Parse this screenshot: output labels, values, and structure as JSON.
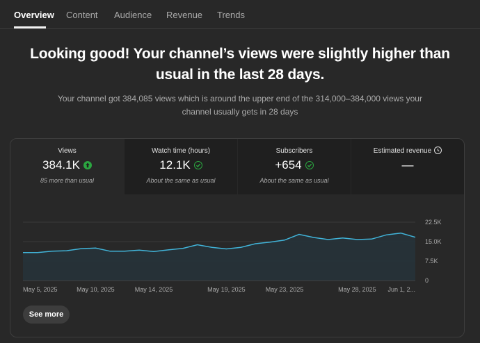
{
  "tabs": [
    {
      "label": "Overview",
      "active": true
    },
    {
      "label": "Content",
      "active": false
    },
    {
      "label": "Audience",
      "active": false
    },
    {
      "label": "Revenue",
      "active": false
    },
    {
      "label": "Trends",
      "active": false
    }
  ],
  "headline": "Looking good! Your channel’s views were slightly higher than usual in the last 28 days.",
  "subtext": "Your channel got 384,085 views which is around the upper end of the 314,000–384,000 views your channel usually gets in 28 days",
  "metrics": [
    {
      "label": "Views",
      "value": "384.1K",
      "note": "85 more than usual",
      "status": "up",
      "selected": true
    },
    {
      "label": "Watch time (hours)",
      "value": "12.1K",
      "note": "About the same as usual",
      "status": "same",
      "selected": false
    },
    {
      "label": "Subscribers",
      "value": "+654",
      "note": "About the same as usual",
      "status": "same",
      "selected": false
    },
    {
      "label": "Estimated revenue",
      "value": "—",
      "note": "",
      "status": "pending",
      "selected": false
    }
  ],
  "see_more_label": "See more",
  "chart_data": {
    "type": "area",
    "series": [
      {
        "values": [
          10800,
          10800,
          11300,
          11500,
          12300,
          12500,
          11300,
          11300,
          11700,
          11200,
          11800,
          12400,
          13800,
          12800,
          12200,
          12800,
          14200,
          14800,
          15600,
          17800,
          16600,
          15800,
          16400,
          15800,
          16000,
          17600,
          18300,
          16700
        ]
      }
    ],
    "x_tick_labels": [
      "May 5, 2025",
      "May 10, 2025",
      "May 14, 2025",
      "May 19, 2025",
      "May 23, 2025",
      "May 28, 2025",
      "Jun 1, 2..."
    ],
    "y_tick_labels": [
      "22.5K",
      "15.0K",
      "7.5K",
      "0"
    ],
    "ylim": [
      0,
      22500
    ],
    "line_color": "#41b4d9",
    "grid": true
  }
}
